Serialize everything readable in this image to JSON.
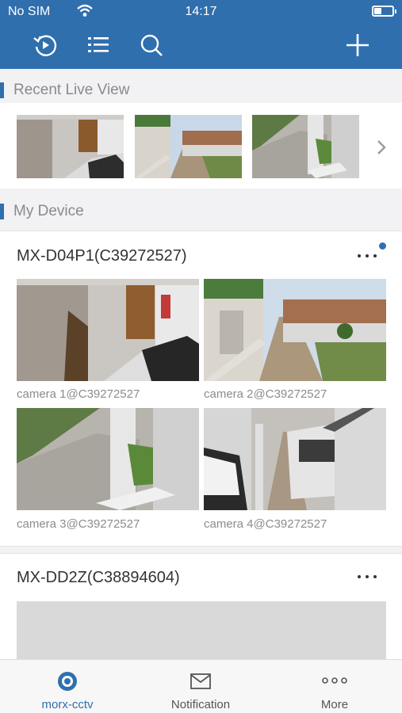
{
  "status": {
    "carrier": "No SIM",
    "time": "14:17"
  },
  "toolbar": {
    "icons": [
      "playback-icon",
      "list-icon",
      "search-icon",
      "add-icon"
    ]
  },
  "recent": {
    "title": "Recent Live View"
  },
  "devices_section": {
    "title": "My Device"
  },
  "devices": [
    {
      "name": "MX-D04P1(C39272527)",
      "cameras": [
        "camera 1@C39272527",
        "camera 2@C39272527",
        "camera 3@C39272527",
        "camera 4@C39272527"
      ]
    },
    {
      "name": "MX-DD2Z(C38894604)",
      "cameras": []
    }
  ],
  "tabs": [
    {
      "label": "morx-cctv",
      "icon": "camera-tab-icon",
      "active": true
    },
    {
      "label": "Notification",
      "icon": "envelope-icon",
      "active": false
    },
    {
      "label": "More",
      "icon": "more-icon",
      "active": false
    }
  ],
  "colors": {
    "accent": "#2f6fae",
    "badge": "#2f6fae",
    "tab_active": "#2f6fae",
    "tab_inactive": "#555555"
  }
}
